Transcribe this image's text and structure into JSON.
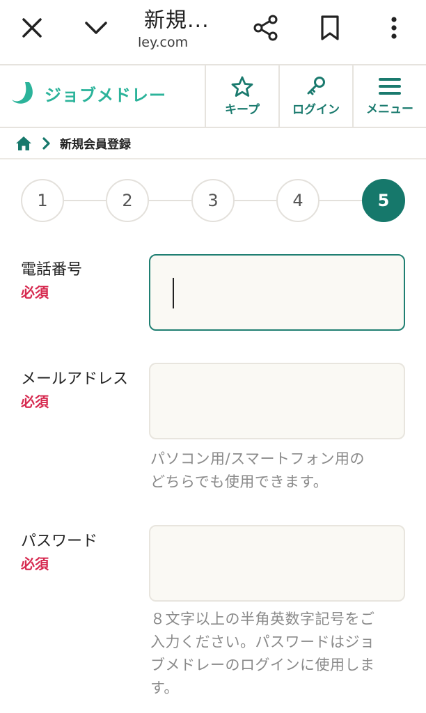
{
  "browser": {
    "title": "新規...",
    "url": "ley.com"
  },
  "site": {
    "logo_text": "ジョブメドレー",
    "nav": {
      "keep_label": "キープ",
      "login_label": "ログイン",
      "menu_label": "メニュー"
    }
  },
  "breadcrumb": {
    "current": "新規会員登録"
  },
  "stepper": {
    "steps": [
      "1",
      "2",
      "3",
      "4",
      "5"
    ],
    "active": "5"
  },
  "form": {
    "phone": {
      "label": "電話番号",
      "required": "必須",
      "value": ""
    },
    "email": {
      "label": "メールアドレス",
      "required": "必須",
      "value": "",
      "hint_line1": "パソコン用/スマートフォン用の",
      "hint_line2": "どちらでも使用できます。"
    },
    "password": {
      "label": "パスワード",
      "required": "必須",
      "value": "",
      "hint_line1": "８文字以上の半角英数字記号をご",
      "hint_line2": "入力ください。パスワードはジョ",
      "hint_line3": "ブメドレーのログインに使用しま",
      "hint_line4": "す。"
    }
  },
  "colors": {
    "brand": "#16786b",
    "logo": "#2bb39a",
    "required": "#d6294f"
  }
}
